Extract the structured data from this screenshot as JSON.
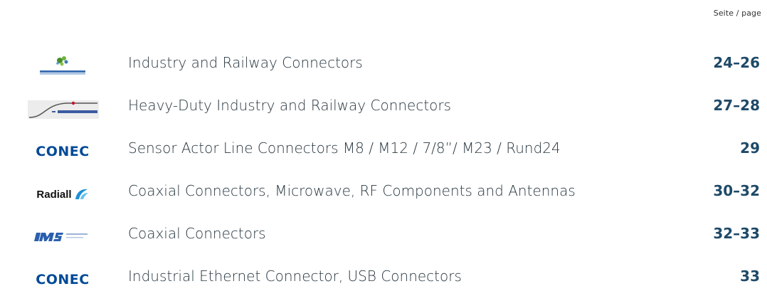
{
  "header": {
    "page_label": "Seite / page"
  },
  "rows": [
    {
      "logo": "staubli-logo",
      "title": "Industry and Railway Connectors",
      "pages": "24–26"
    },
    {
      "logo": "schaltbau-logo",
      "title": "Heavy-Duty Industry and Railway Connectors",
      "pages": "27–28"
    },
    {
      "logo": "conec-logo",
      "logo_text": "CONEC",
      "title": "Sensor Actor Line Connectors M8 / M12 / 7/8”/ M23 / Rund24",
      "pages": "29"
    },
    {
      "logo": "radiall-logo",
      "logo_text": "Radiall",
      "title": "Coaxial Connectors, Microwave, RF Components and Antennas",
      "pages": "30–32"
    },
    {
      "logo": "ims-logo",
      "title": "Coaxial Connectors",
      "pages": "32–33"
    },
    {
      "logo": "conec-logo",
      "logo_text": "CONEC",
      "title": "Industrial Ethernet Connector, USB Connectors",
      "pages": "33"
    }
  ],
  "colors": {
    "page_numbers": "#1e4a68",
    "conec_blue": "#004a98",
    "ims_blue": "#2a5fae"
  }
}
